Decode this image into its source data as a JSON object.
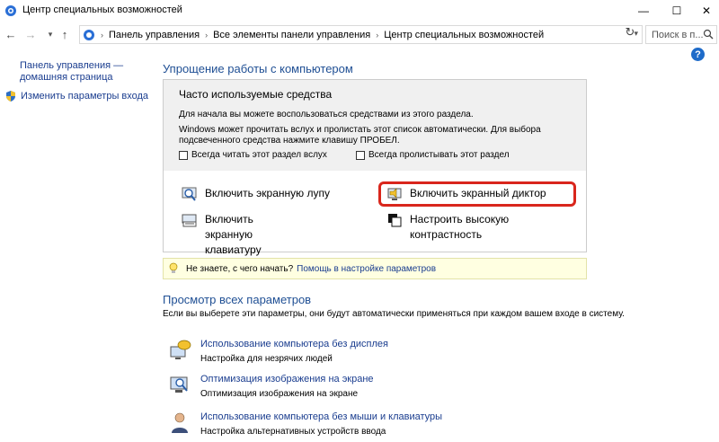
{
  "window": {
    "title": "Центр специальных возможностей",
    "min_glyph": "—",
    "max_glyph": "☐",
    "close_glyph": "✕"
  },
  "address": {
    "crumbs": [
      "Панель управления",
      "Все элементы панели управления",
      "Центр специальных возможностей"
    ],
    "search_placeholder": "Поиск в п..."
  },
  "leftnav": {
    "home_link": "Панель управления — домашняя страница",
    "signin_link": "Изменить параметры входа"
  },
  "help_glyph": "?",
  "quick": {
    "heading": "Упрощение работы с компьютером",
    "box_title": "Часто используемые средства",
    "p1": "Для начала вы можете воспользоваться средствами из этого раздела.",
    "p2": "Windows может прочитать вслух и пролистать этот список автоматически. Для выбора подсвеченного средства нажмите клавишу ПРОБЕЛ.",
    "chk_read": "Всегда читать этот раздел вслух",
    "chk_scroll": "Всегда пролистывать этот раздел",
    "tools": {
      "magnifier": "Включить экранную лупу",
      "narrator": "Включить экранный диктор",
      "keyboard": "Включить экранную клавиатуру",
      "contrast": "Настроить высокую контрастность"
    }
  },
  "tip": {
    "text": "Не знаете, с чего начать?",
    "link": "Помощь в настройке параметров"
  },
  "all": {
    "heading": "Просмотр всех параметров",
    "desc": "Если вы выберете эти параметры, они будут автоматически применяться при каждом вашем входе в систему.",
    "options": [
      {
        "link": "Использование компьютера без дисплея",
        "desc": "Настройка для незрячих людей"
      },
      {
        "link": "Оптимизация изображения на экране",
        "desc": "Оптимизация изображения на экране"
      },
      {
        "link": "Использование компьютера без мыши и клавиатуры",
        "desc": "Настройка альтернативных устройств ввода"
      }
    ]
  },
  "colors": {
    "link": "#1a3d8f",
    "heading": "#1f4f94",
    "highlight": "#d9261c",
    "tip_bg": "#ffffe1"
  }
}
